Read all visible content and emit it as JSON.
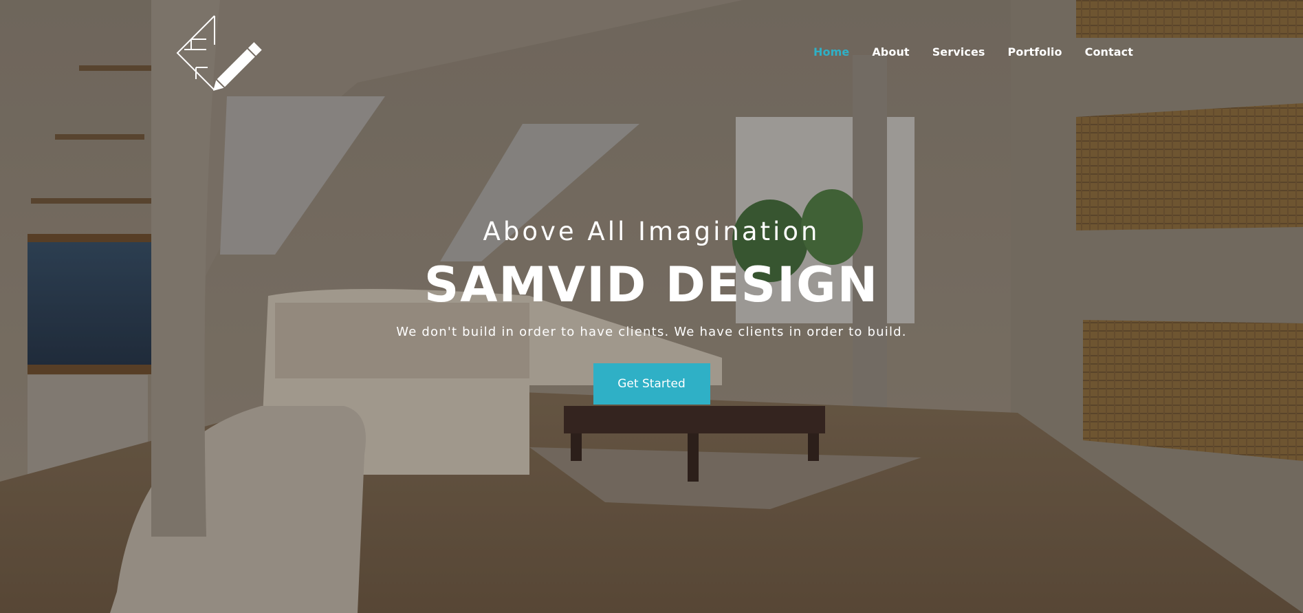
{
  "nav": {
    "items": [
      {
        "label": "Home",
        "active": true
      },
      {
        "label": "About",
        "active": false
      },
      {
        "label": "Services",
        "active": false
      },
      {
        "label": "Portfolio",
        "active": false
      },
      {
        "label": "Contact",
        "active": false
      }
    ]
  },
  "hero": {
    "tagline": "Above All Imagination",
    "title": "SAMVID DESIGN",
    "subtitle": "We don't build in order to have clients. We have clients in order to build.",
    "cta_label": "Get Started",
    "background_image": "interior-loft-living-room"
  },
  "logo": {
    "icon": "pencil-ruler-logo-icon"
  },
  "colors": {
    "accent": "#2fb0c6",
    "text": "#ffffff",
    "overlay": "rgba(40,34,28,0.28)"
  }
}
